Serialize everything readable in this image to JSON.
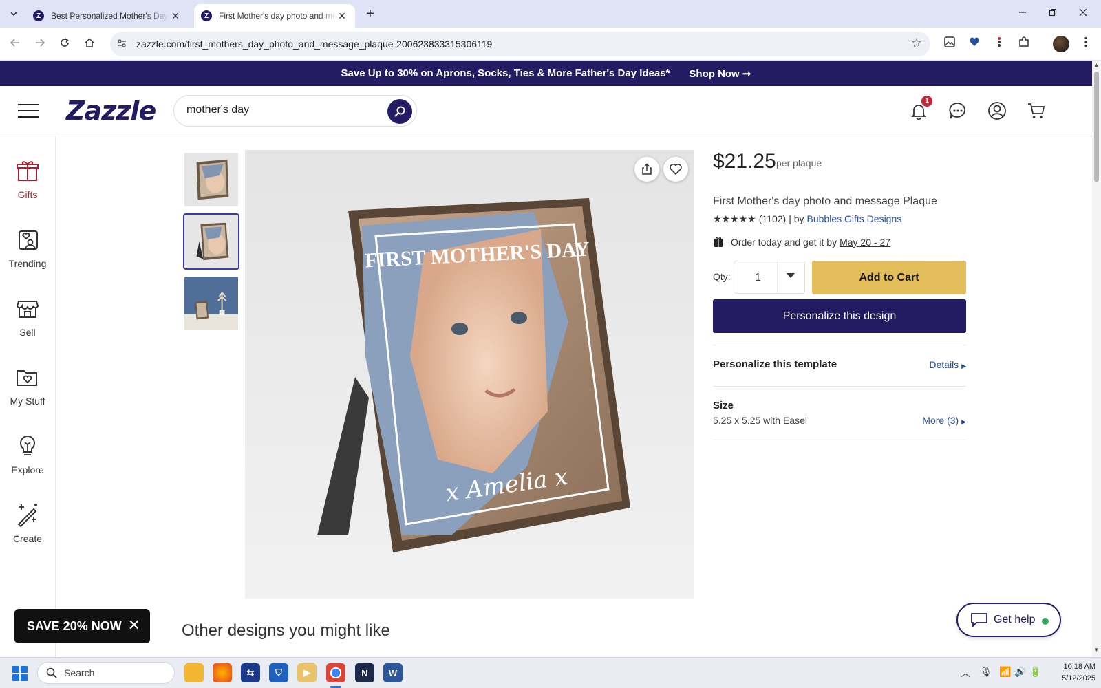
{
  "browser": {
    "tabs": [
      {
        "title": "Best Personalized Mother's Day Gifts",
        "active": false
      },
      {
        "title": "First Mother's day photo and message Plaque",
        "active": true
      }
    ],
    "url": "zazzle.com/first_mothers_day_photo_and_message_plaque-200623833315306119"
  },
  "promo": {
    "text": "Save Up to 30% on Aprons, Socks, Ties & More Father's Day Ideas*",
    "cta": "Shop Now ➞"
  },
  "header": {
    "logo": "Zazzle",
    "search_value": "mother's day",
    "notification_count": "1"
  },
  "sidebar": {
    "items": [
      {
        "label": "Gifts",
        "icon": "gift-icon"
      },
      {
        "label": "Trending",
        "icon": "trending-heart-icon"
      },
      {
        "label": "Sell",
        "icon": "storefront-icon"
      },
      {
        "label": "My Stuff",
        "icon": "folder-heart-icon"
      },
      {
        "label": "Explore",
        "icon": "lightbulb-icon"
      },
      {
        "label": "Create",
        "icon": "magic-wand-icon"
      }
    ]
  },
  "product_image": {
    "plaque_heading": "FIRST MOTHER'S DAY",
    "plaque_name": "x Amelia x",
    "selected_thumbnail": 2
  },
  "product": {
    "price": "$21.25",
    "price_unit": "per plaque",
    "title": "First Mother's day photo and message Plaque",
    "stars": "★★★★★",
    "rating_count": "(1102)",
    "by_label": "| by",
    "seller": "Bubbles Gifts Designs",
    "delivery_prefix": "Order today and get it by",
    "delivery_dates": "May 20 - 27",
    "qty_label": "Qty:",
    "qty_value": "1",
    "add_to_cart": "Add to Cart",
    "personalize_button": "Personalize this design",
    "template_title": "Personalize this template",
    "details_link": "Details",
    "size_title": "Size",
    "size_value": "5.25 x 5.25 with Easel",
    "size_more": "More (3)"
  },
  "bottom": {
    "other_designs": "Other designs you might like",
    "save_pill": "SAVE 20% NOW",
    "get_help": "Get help"
  },
  "taskbar": {
    "search_placeholder": "Search",
    "time": "10:18 AM",
    "date": "5/12/2025"
  },
  "colors": {
    "brand_purple": "#241c63",
    "add_to_cart_gold": "#e2bd59",
    "gift_red": "#a32334",
    "link_blue": "#2a4f9a"
  }
}
